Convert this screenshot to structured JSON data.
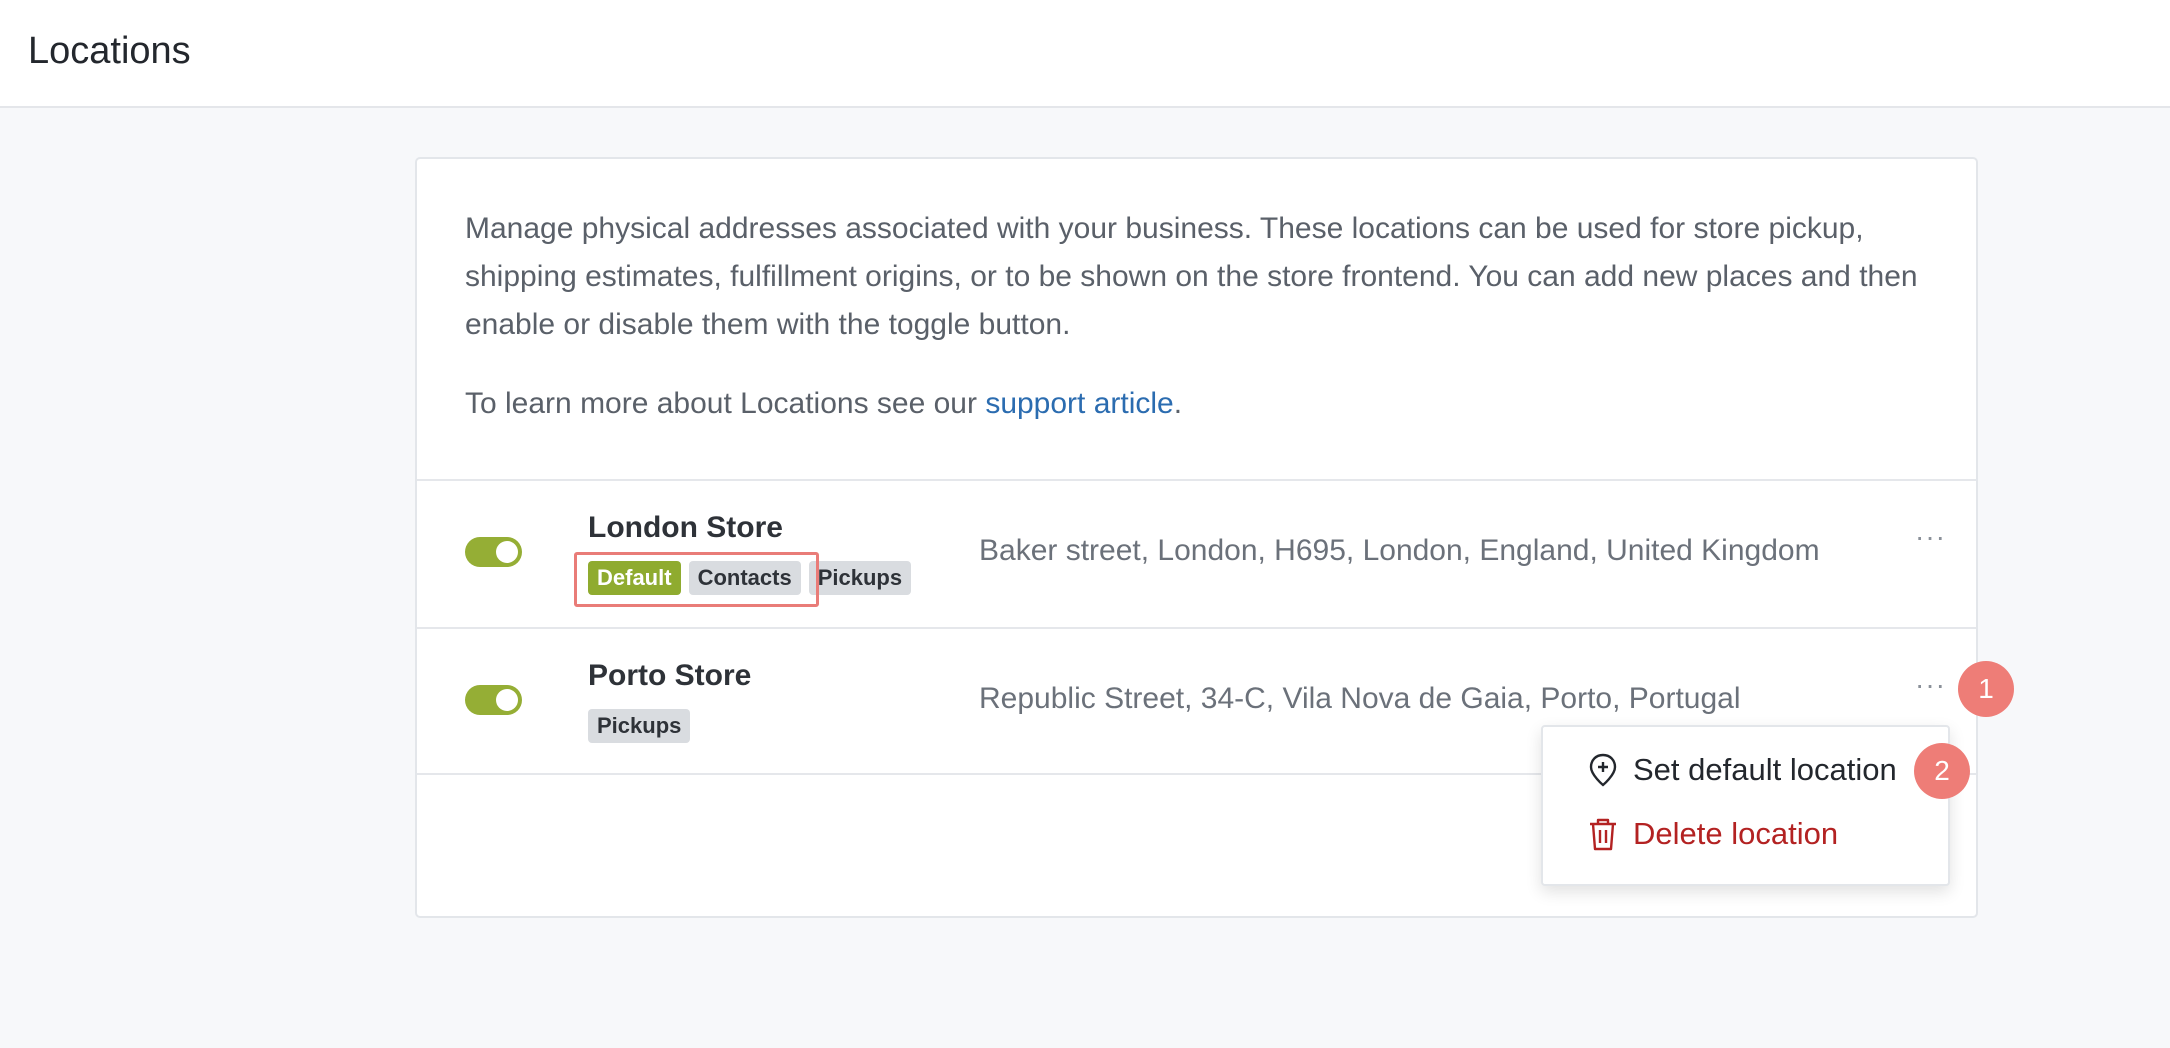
{
  "header": {
    "title": "Locations"
  },
  "intro": {
    "description": "Manage physical addresses associated with your business. These locations can be used for store pickup, shipping estimates, fulfillment origins, or to be shown on the store frontend. You can add new places and then enable or disable them with the toggle button.",
    "learn_prefix": "To learn more about Locations see our ",
    "learn_link": "support article",
    "learn_suffix": "."
  },
  "locations": [
    {
      "name": "London Store",
      "enabled": true,
      "badges": [
        "Default",
        "Contacts",
        "Pickups"
      ],
      "address": "Baker street, London, H695, London, England, United Kingdom",
      "more_label": "···"
    },
    {
      "name": "Porto Store",
      "enabled": true,
      "badges": [
        "Pickups"
      ],
      "address": "Republic Street, 34-C, Vila Nova de Gaia, Porto, Portugal",
      "more_label": "···"
    }
  ],
  "menu": {
    "set_default_label": "Set default location",
    "set_default_icon": "location-pin-plus-icon",
    "delete_label": "Delete location",
    "delete_icon": "trash-icon"
  },
  "annotations": {
    "marker_1": "1",
    "marker_2": "2"
  },
  "colors": {
    "toggle_on": "#95ae35",
    "default_badge": "#8fab2f",
    "link": "#2b6cb0",
    "delete": "#b32222",
    "annotation": "#ee7d77"
  }
}
